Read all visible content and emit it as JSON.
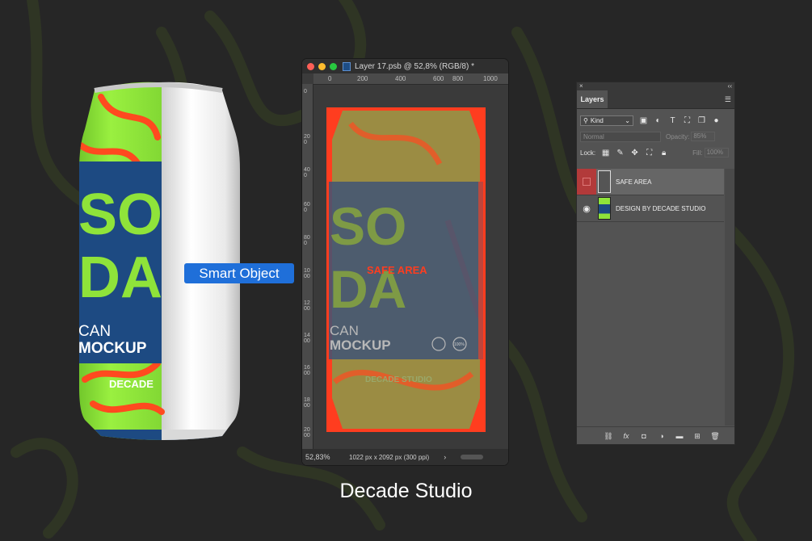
{
  "colors": {
    "background": "#262626",
    "can_green": "#8fe33a",
    "can_blue": "#1d4a82",
    "accent_red": "#ff3d1f",
    "smart_blue": "#1f6fd9"
  },
  "can": {
    "word1": "SO",
    "word2": "DA",
    "line1": "CAN",
    "line2": "MOCKUP",
    "brand": "DECADE"
  },
  "smart_object_label": "Smart Object",
  "ps_window": {
    "title": "Layer 17.psb @ 52,8% (RGB/8) *",
    "ruler_top": [
      "0",
      "200",
      "400",
      "600",
      "800",
      "1000"
    ],
    "ruler_left": [
      "0",
      "200",
      "400",
      "600",
      "800",
      "1000",
      "1200",
      "1400",
      "1600",
      "1800",
      "2000"
    ],
    "art": {
      "word1": "SO",
      "word2": "DA",
      "safe_label": "SAFE AREA",
      "line1": "CAN",
      "line2": "MOCKUP",
      "brand": "DECADE STUDIO",
      "badge": "100%"
    },
    "zoom": "52,83%",
    "doc_info": "1022 px x 2092 px (300 ppi)"
  },
  "layers_panel": {
    "tab": "Layers",
    "filter_kind": "Kind",
    "blend_mode": "Normal",
    "opacity_label": "Opacity:",
    "opacity_value": "85%",
    "lock_label": "Lock:",
    "fill_label": "Fill:",
    "fill_value": "100%",
    "layers": [
      {
        "name": "SAFE AREA",
        "visible": false,
        "selected": true
      },
      {
        "name": "DESIGN BY DECADE STUDIO",
        "visible": true,
        "selected": false
      }
    ]
  },
  "caption": "Decade Studio"
}
